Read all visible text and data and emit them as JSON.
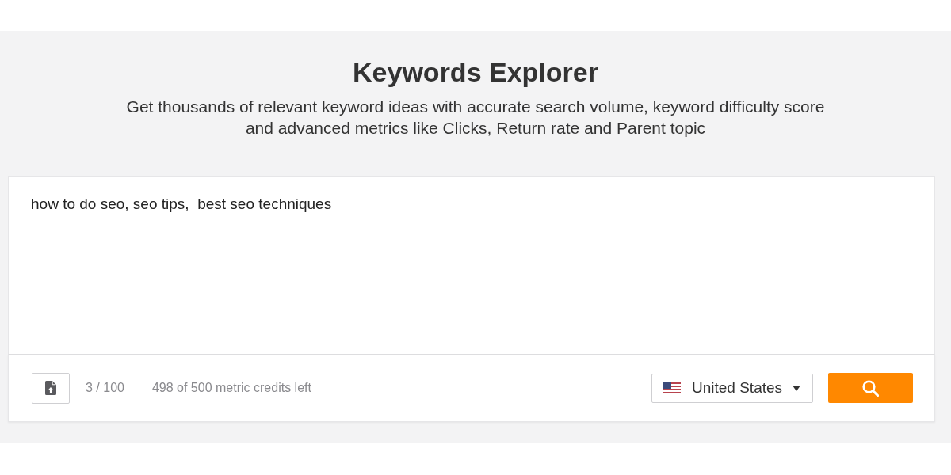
{
  "header": {
    "title": "Keywords Explorer",
    "subtitle": "Get thousands of relevant keyword ideas with accurate search volume, keyword difficulty score and advanced metrics like Clicks, Return rate and Parent topic"
  },
  "search_box": {
    "value": "how to do seo, seo tips,  best seo techniques"
  },
  "footer": {
    "keyword_count": "3 / 100",
    "credits": "498 of 500 metric credits left",
    "country": "United States"
  }
}
